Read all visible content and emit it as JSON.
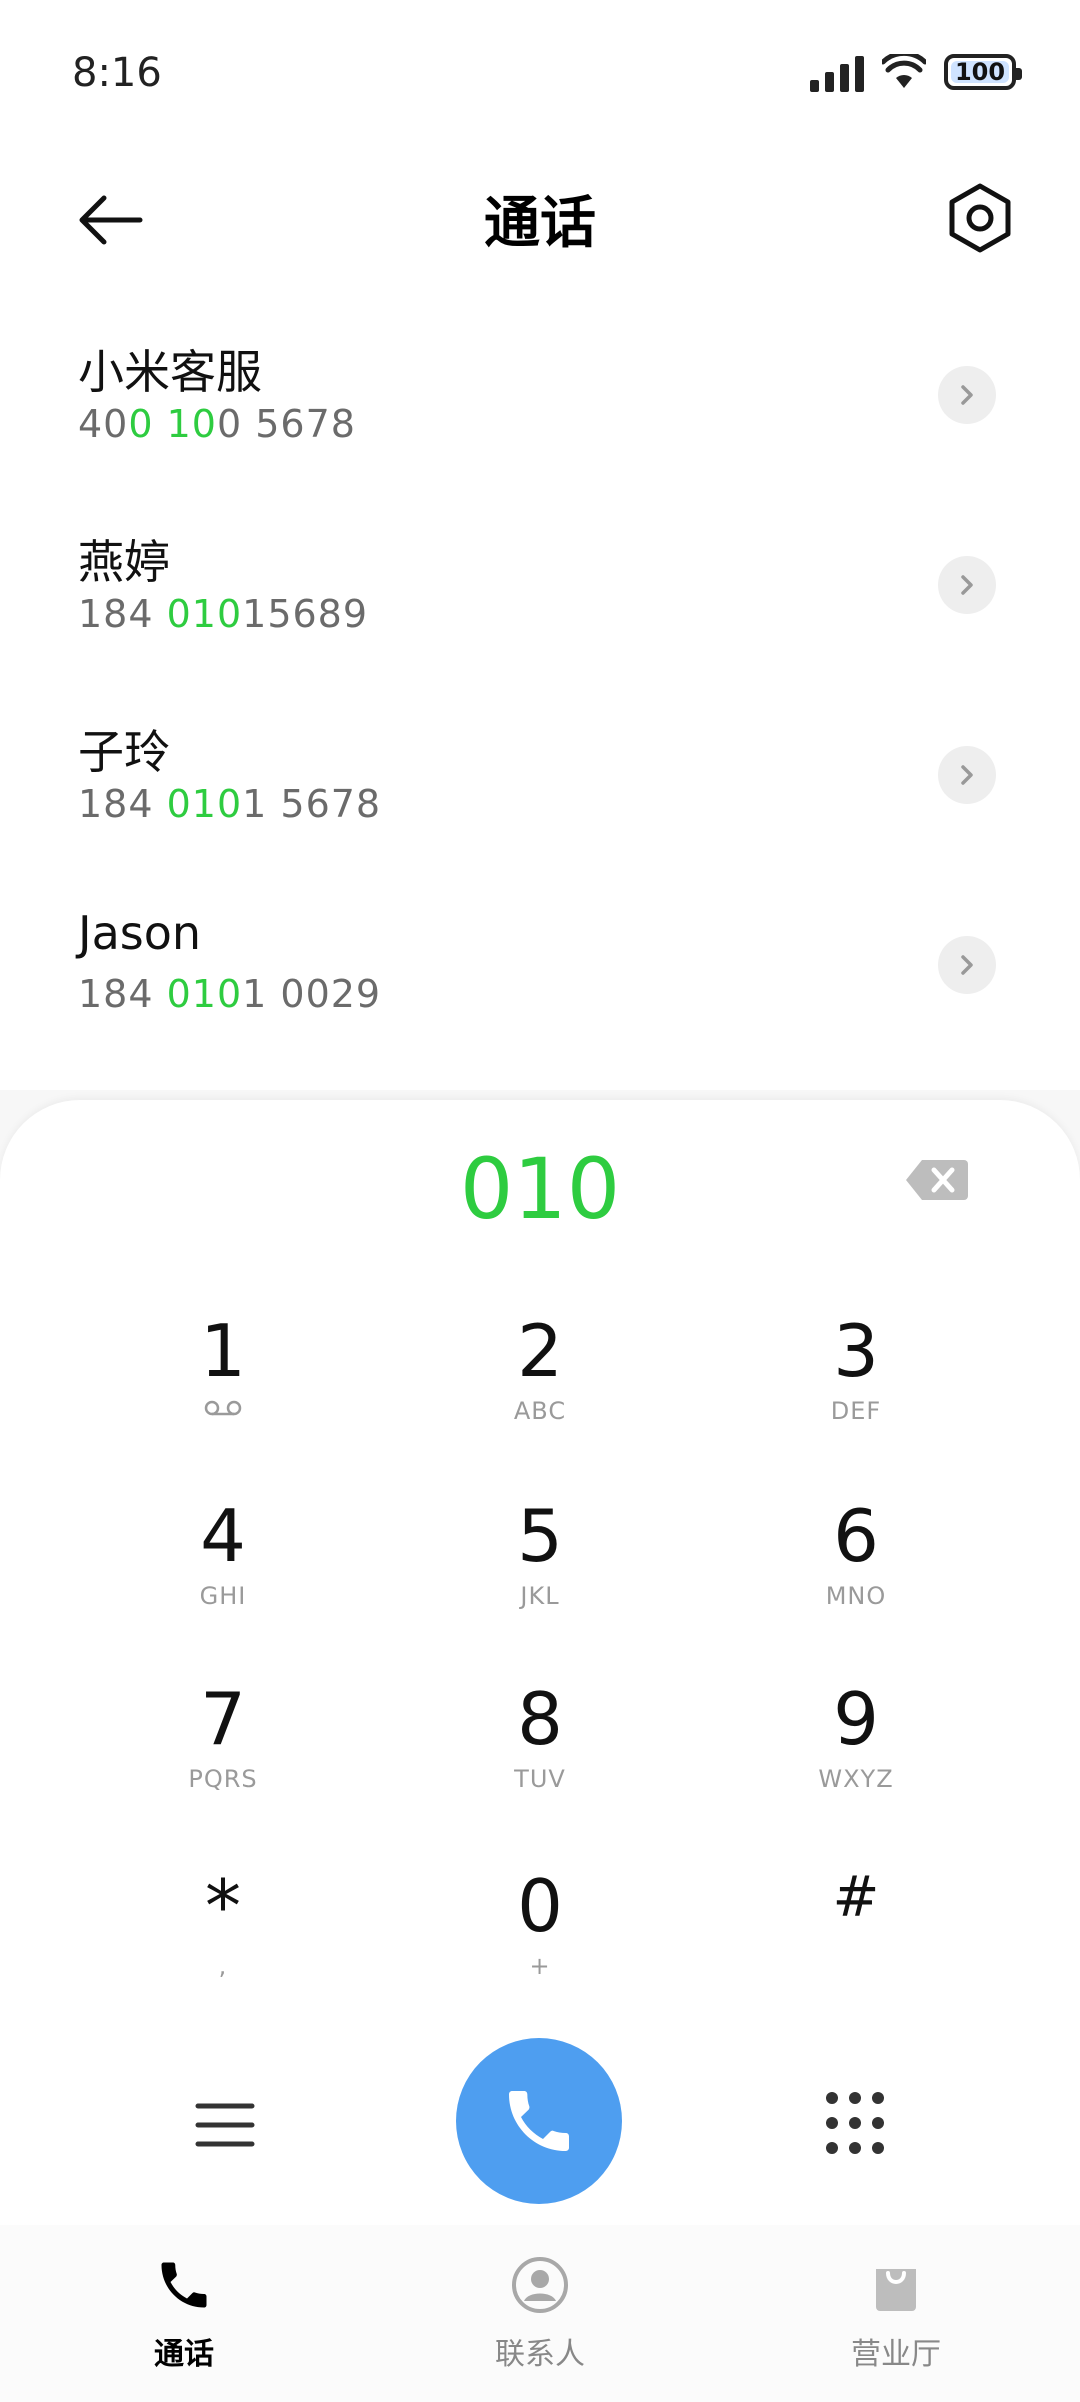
{
  "status": {
    "time": "8:16",
    "battery": "100"
  },
  "header": {
    "title": "通话"
  },
  "results": [
    {
      "name": "小米客服",
      "num_parts": [
        {
          "t": "40",
          "h": false
        },
        {
          "t": "0 10",
          "h": true
        },
        {
          "t": "0 5678",
          "h": false
        }
      ]
    },
    {
      "name": "燕婷",
      "num_parts": [
        {
          "t": "184 ",
          "h": false
        },
        {
          "t": "010",
          "h": true
        },
        {
          "t": "15689",
          "h": false
        }
      ]
    },
    {
      "name": "子玲",
      "num_parts": [
        {
          "t": "184 ",
          "h": false
        },
        {
          "t": "010",
          "h": true
        },
        {
          "t": "1 5678",
          "h": false
        }
      ]
    },
    {
      "name": "Jason",
      "num_parts": [
        {
          "t": "184 ",
          "h": false
        },
        {
          "t": "010",
          "h": true
        },
        {
          "t": "1 0029",
          "h": false
        }
      ]
    }
  ],
  "dialpad": {
    "entry": "010",
    "keys": [
      {
        "digit": "1",
        "letters": ""
      },
      {
        "digit": "2",
        "letters": "ABC"
      },
      {
        "digit": "3",
        "letters": "DEF"
      },
      {
        "digit": "4",
        "letters": "GHI"
      },
      {
        "digit": "5",
        "letters": "JKL"
      },
      {
        "digit": "6",
        "letters": "MNO"
      },
      {
        "digit": "7",
        "letters": "PQRS"
      },
      {
        "digit": "8",
        "letters": "TUV"
      },
      {
        "digit": "9",
        "letters": "WXYZ"
      },
      {
        "digit": "*",
        "letters": ","
      },
      {
        "digit": "0",
        "letters": "+"
      },
      {
        "digit": "#",
        "letters": ""
      }
    ]
  },
  "nav": {
    "calls": "通话",
    "contacts": "联系人",
    "store": "营业厅"
  },
  "colors": {
    "highlight": "#2ecc40",
    "call_button": "#4e9ef0"
  }
}
